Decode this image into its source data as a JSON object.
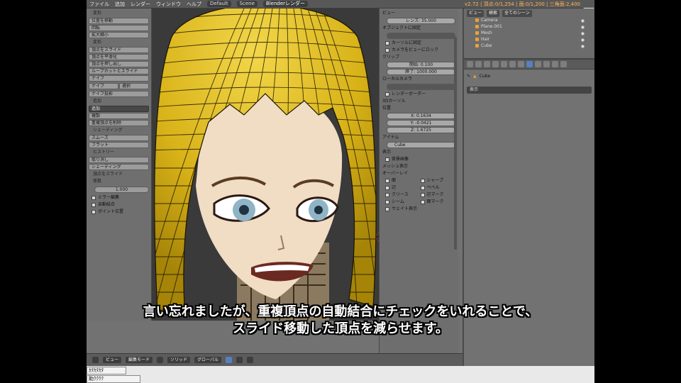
{
  "topbar": {
    "menu": [
      "ファイル",
      "追加",
      "レンダー",
      "ウィンドウ",
      "ヘルプ"
    ],
    "layout": "Default",
    "scene": "Scene",
    "engine": "Blenderレンダー",
    "stats": "v2.72 | 頂点:0/1,254 | 面:0/1,200 | 三角面:2,400"
  },
  "toolshelf": {
    "sec_transform": "変形",
    "transform": [
      "位置を移動",
      "回転",
      "拡大縮小"
    ],
    "sec_deform": "変形",
    "deform": [
      "頂点をスライド",
      "頂点を平滑化",
      "頂点を押し出し",
      "ループカットとスライド",
      "ナイフ"
    ],
    "split_a": "ナイフ",
    "split_b": "選択",
    "deform2": [
      "ナイフ投影"
    ],
    "sec_add": "追加",
    "add_dropdown": "追加",
    "add": [
      "複製",
      "重複頂点を削除"
    ],
    "sec_shade": "シェーディング",
    "shade": [
      "スムーズ",
      "フラット"
    ],
    "sec_history": "ヒストリー",
    "history": [
      "取り消し",
      "シェーディング"
    ],
    "sec_slide": "頂点をスライド",
    "factor_label": "係数",
    "factor": "1.000",
    "checks": [
      "ミラー編集",
      "自動結合",
      "ポイント位置"
    ]
  },
  "viewport": {
    "header": {
      "mode": "編集モード",
      "shading": "ソリッド",
      "pivot": "グローバル",
      "view": "ビュー"
    }
  },
  "npanel": {
    "sec_view": "ビュー",
    "lens": "レンズ: 35.000",
    "lock_label": "オブジェクトに固定",
    "lock_field": "",
    "lock_checks": [
      "カーソルに固定",
      "カメラをビューにロック"
    ],
    "sec_clip": "クリップ",
    "clip_start": "開始: 0.100",
    "clip_end": "終了: 1000.000",
    "sec_local_cam": "ローカルカメラ",
    "local_cam": "",
    "render_border": "レンダーボーダー",
    "sec_cursor": "3Dカーソル",
    "sec_location": "位置",
    "loc_x": "X: 0.1634",
    "loc_y": "Y: -0.0421",
    "loc_z": "Z: 1.6725",
    "sec_item": "アイテム",
    "item_name": "Cube",
    "sec_display": "表示",
    "sec_bg": "背景画像",
    "sec_mesh": "メッシュ表示",
    "overlay_label": "オーバーレイ",
    "overlay_left": [
      "面",
      "辺",
      "クリース",
      "シーム"
    ],
    "overlay_right": [
      "シャープ",
      "ベベル",
      "辺マーク",
      "面マーク"
    ],
    "weight": "ウェイト表示"
  },
  "outliner": {
    "view": "ビュー",
    "search": "検索",
    "filter": "全てのシーン",
    "items": [
      "Camera",
      "Plane.001",
      "Mesh",
      "Hair",
      "Cube"
    ]
  },
  "properties": {
    "object": "Cube",
    "dropdown": "表示"
  },
  "tasks": [
    "ｶﾀｶﾀｶﾀ",
    "助ｸｸｸｸ"
  ],
  "subtitle": {
    "line1": "言い忘れましたが、重複頂点の自動結合にチェックをいれることで、",
    "line2": "スライド移動した頂点を減らせます。"
  },
  "colors": {
    "hair": "#d8b218",
    "mesh_line": "#1b1500",
    "skin": "#f1dcc4",
    "ui_bg": "#727272",
    "accent": "#5680c2"
  }
}
